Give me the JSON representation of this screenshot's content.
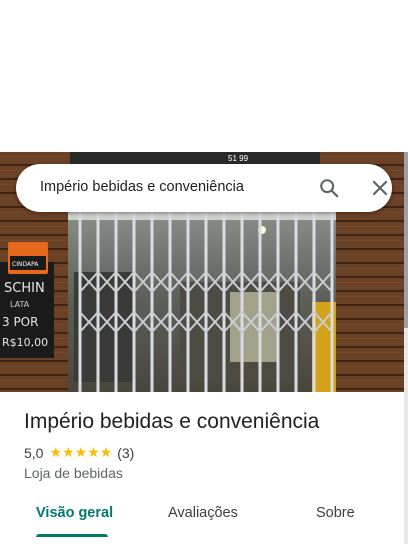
{
  "search": {
    "query": "Império bebidas e conveniência"
  },
  "icons": {
    "search": "search-icon",
    "close": "close-icon",
    "star": "star-icon"
  },
  "photo": {
    "sign_text_lines": [
      "SCHIN",
      "LATA",
      "3 POR",
      "R$10,00"
    ],
    "badge_text": "CINDAPA",
    "top_banner_text": "51 99"
  },
  "place": {
    "name": "Império bebidas e conveniência",
    "rating": "5,0",
    "stars": "★★★★★",
    "review_count": "(3)",
    "category": "Loja de bebidas"
  },
  "tabs": [
    {
      "label": "Visão geral",
      "active": true
    },
    {
      "label": "Avaliações",
      "active": false
    },
    {
      "label": "Sobre",
      "active": false
    }
  ],
  "colors": {
    "accent": "#00796b",
    "star": "#fbbc04"
  }
}
